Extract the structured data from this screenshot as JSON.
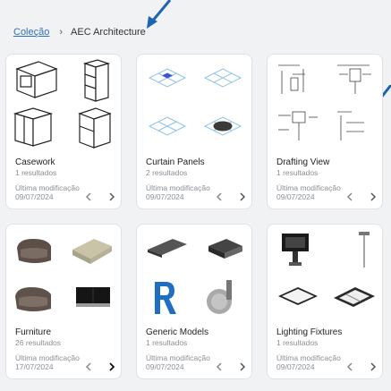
{
  "breadcrumb": {
    "link": "Coleção",
    "separator": "›",
    "current": "AEC Architecture"
  },
  "cards": [
    {
      "title": "Casework",
      "count": "1 resultados",
      "modified_label": "Última modificação",
      "modified_date": "09/07/2024"
    },
    {
      "title": "Curtain Panels",
      "count": "2 resultados",
      "modified_label": "Última modificação",
      "modified_date": "09/07/2024"
    },
    {
      "title": "Drafting View",
      "count": "1 resultados",
      "modified_label": "Última modificação",
      "modified_date": "09/07/2024"
    },
    {
      "title": "Furniture",
      "count": "26 resultados",
      "modified_label": "Última modificação",
      "modified_date": "17/07/2024"
    },
    {
      "title": "Generic Models",
      "count": "1 resultados",
      "modified_label": "Última modificação",
      "modified_date": "09/07/2024"
    },
    {
      "title": "Lighting Fixtures",
      "count": "1 resultados",
      "modified_label": "Última modificação",
      "modified_date": "09/07/2024"
    }
  ],
  "colors": {
    "link": "#2f6fb5",
    "annotation_arrow": "#1f64b0",
    "card_border": "#dfe1e5",
    "page_bg": "#f1f2f4"
  },
  "icons": [
    "chevron-left-icon",
    "chevron-right-icon",
    "annotation-arrow-icon"
  ]
}
